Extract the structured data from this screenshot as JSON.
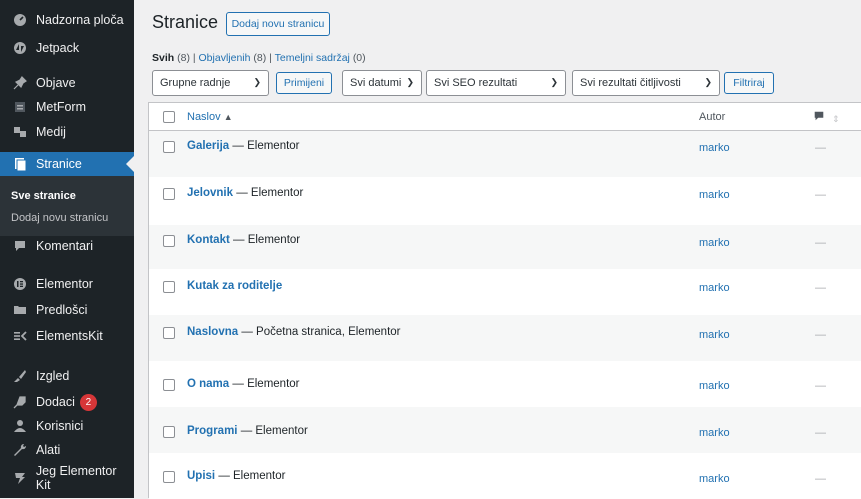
{
  "sidebar": {
    "items": [
      {
        "label": "Nadzorna ploča",
        "icon": "dashboard-icon"
      },
      {
        "label": "Jetpack",
        "icon": "jetpack-icon"
      },
      {
        "label": "Objave",
        "icon": "pin-icon"
      },
      {
        "label": "MetForm",
        "icon": "metform-icon"
      },
      {
        "label": "Medij",
        "icon": "media-icon"
      },
      {
        "label": "Stranice",
        "icon": "page-icon"
      },
      {
        "label": "Komentari",
        "icon": "comment-icon"
      },
      {
        "label": "Elementor",
        "icon": "elementor-icon"
      },
      {
        "label": "Predlošci",
        "icon": "folder-icon"
      },
      {
        "label": "ElementsKit",
        "icon": "elementskit-icon"
      },
      {
        "label": "Izgled",
        "icon": "brush-icon"
      },
      {
        "label": "Dodaci",
        "icon": "plugin-icon",
        "badge": "2"
      },
      {
        "label": "Korisnici",
        "icon": "users-icon"
      },
      {
        "label": "Alati",
        "icon": "tools-icon"
      },
      {
        "label": "Jeg Elementor Kit",
        "icon": "jeg-icon"
      }
    ],
    "submenu": [
      "Sve stranice",
      "Dodaj novu stranicu"
    ]
  },
  "header": {
    "title": "Stranice",
    "add_new": "Dodaj novu stranicu"
  },
  "filters_links": {
    "all": "Svih",
    "all_count": "(8)",
    "published": "Objavljenih",
    "published_count": "(8)",
    "cornerstone": "Temeljni sadržaj",
    "cornerstone_count": "(0)"
  },
  "toolbar": {
    "bulk": "Grupne radnje",
    "apply": "Primijeni",
    "dates": "Svi datumi",
    "seo": "Svi SEO rezultati",
    "readability": "Svi rezultati čitljivosti",
    "filter": "Filtriraj"
  },
  "table": {
    "col_title": "Naslov",
    "col_author": "Autor",
    "rows": [
      {
        "title": "Galerija",
        "suffix": " — Elementor",
        "author": "marko",
        "comments": "—"
      },
      {
        "title": "Jelovnik",
        "suffix": " — Elementor",
        "author": "marko",
        "comments": "—"
      },
      {
        "title": "Kontakt",
        "suffix": " — Elementor",
        "author": "marko",
        "comments": "—"
      },
      {
        "title": "Kutak za roditelje",
        "suffix": "",
        "author": "marko",
        "comments": "—"
      },
      {
        "title": "Naslovna",
        "suffix": " — Početna stranica, Elementor",
        "author": "marko",
        "comments": "—"
      },
      {
        "title": "O nama",
        "suffix": " — Elementor",
        "author": "marko",
        "comments": "—"
      },
      {
        "title": "Programi",
        "suffix": " — Elementor",
        "author": "marko",
        "comments": "—"
      },
      {
        "title": "Upisi",
        "suffix": " — Elementor",
        "author": "marko",
        "comments": "—"
      }
    ]
  },
  "colors": {
    "sidebar": "#1d2327",
    "accent": "#2271b1",
    "badge": "#d63638"
  }
}
